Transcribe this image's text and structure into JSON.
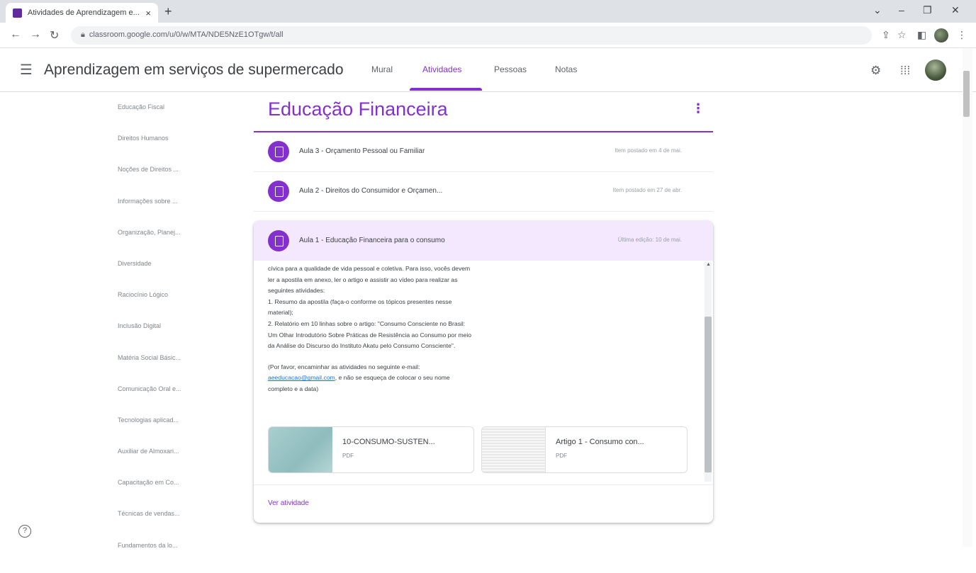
{
  "browser": {
    "tab_title": "Atividades de Aprendizagem e...",
    "url": "classroom.google.com/u/0/w/MTA/NDE5NzE1OTgw/t/all",
    "new_tab": "+",
    "close_tab": "×"
  },
  "header": {
    "course_title": "Aprendizagem em serviços de supermercado",
    "tabs": [
      {
        "label": "Mural"
      },
      {
        "label": "Atividades"
      },
      {
        "label": "Pessoas"
      },
      {
        "label": "Notas"
      }
    ],
    "active_tab": "Atividades"
  },
  "sidebar": {
    "topics": [
      "Educação Fiscal",
      "Direitos Humanos",
      "Noções de Direitos ...",
      "Informações sobre ...",
      "Organização, Planej...",
      "Diversidade",
      "Raciocínio Lógico",
      "Inclusão Digital",
      "Matéria Social Básic...",
      "Comunicação Oral e...",
      "Tecnologias aplicad...",
      "Auxiliar de Almoxari...",
      "Capacitação em Co...",
      "Técnicas de vendas...",
      "Fundamentos da lo..."
    ]
  },
  "topic": {
    "title": "Educação Financeira",
    "items": [
      {
        "title": "Aula 3 - Orçamento Pessoal ou Familiar",
        "date": "Item postado em 4 de mai."
      },
      {
        "title": "Aula 2 - Direitos do Consumidor e Orçamen...",
        "date": "Item postado em 27 de abr."
      }
    ],
    "expanded": {
      "title": "Aula 1 - Educação Financeira para o consumo",
      "date": "Última edição: 10 de mai.",
      "body_lines": [
        "cívica para a qualidade de vida pessoal e coletiva. Para isso, vocês devem",
        "ler a apostila em anexo, ler o artigo e assistir ao vídeo para realizar as",
        "seguintes atividades:",
        "1. Resumo da apostila (faça-o conforme os tópicos presentes nesse",
        "material);",
        "2. Relatório em 10 linhas sobre o artigo: \"Consumo Consciente no Brasil:",
        "Um Olhar Introdutório Sobre Práticas de Resistência ao Consumo por meio",
        "da Análise do Discurso do Instituto Akatu pelo Consumo Consciente\"."
      ],
      "footer_line1": "(Por favor, encaminhar as atividades no seguinte e-mail:",
      "email": "aeeducacao@gmail.com",
      "footer_line2_rest": ", e não se esqueça de colocar o seu nome",
      "footer_line3": "completo e a data)",
      "attachments": [
        {
          "name": "10-CONSUMO-SUSTEN...",
          "type": "PDF"
        },
        {
          "name": "Artigo 1 - Consumo con...",
          "type": "PDF"
        }
      ],
      "view_label": "Ver atividade"
    }
  },
  "help_label": "?"
}
